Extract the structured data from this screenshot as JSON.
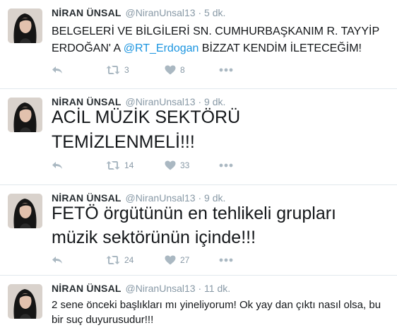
{
  "tweets": [
    {
      "fullname": "NİRAN ÜNSAL",
      "username": "@NiranUnsal13",
      "time": "5 dk.",
      "text_before": "BELGELERİ VE BİLGİLERİ  SN. CUMHURBAŞKANIM R. TAYYİP ERDOĞAN' A ",
      "mention": "@RT_Erdogan",
      "text_after": " BİZZAT KENDİM İLETECEĞİM!",
      "retweets": "3",
      "likes": "8"
    },
    {
      "fullname": "NİRAN ÜNSAL",
      "username": "@NiranUnsal13",
      "time": "9 dk.",
      "text": "ACİL MÜZİK SEKTÖRÜ TEMİZLENMELİ!!!",
      "retweets": "14",
      "likes": "33"
    },
    {
      "fullname": "NİRAN ÜNSAL",
      "username": "@NiranUnsal13",
      "time": "9 dk.",
      "text": "FETÖ örgütünün en tehlikeli grupları müzik sektörünün içinde!!!",
      "retweets": "24",
      "likes": "27"
    },
    {
      "fullname": "NİRAN ÜNSAL",
      "username": "@NiranUnsal13",
      "time": "11 dk.",
      "text": "2 sene önceki  başlıkları mı yineliyorum! Ok yay dan çıktı nasıl olsa, bu bir suç duyurusudur!!!"
    }
  ],
  "icons": {
    "reply": "reply-icon",
    "retweet": "retweet-icon",
    "like": "heart-icon",
    "more": "more-icon"
  },
  "colors": {
    "mention": "#1b95e0",
    "meta": "#8899a6",
    "action": "#aab8c2",
    "divider": "#e1e8ed"
  }
}
